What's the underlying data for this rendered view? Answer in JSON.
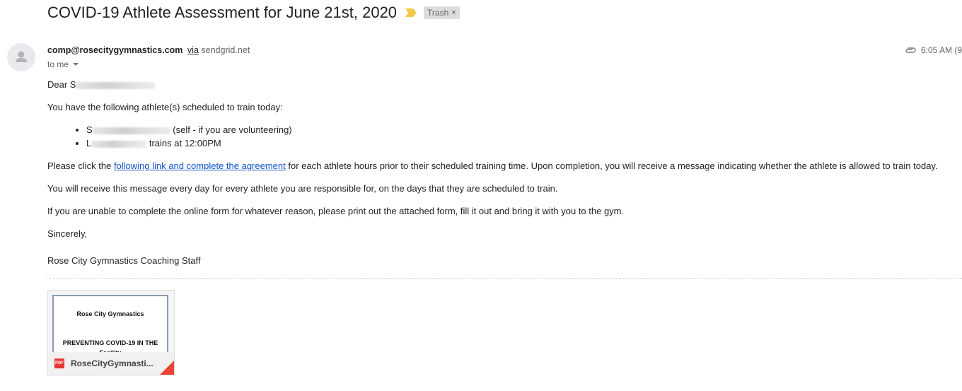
{
  "subject": "COVID-19 Athlete Assessment for June 21st, 2020",
  "label": {
    "name": "Trash",
    "remove": "×"
  },
  "sender": {
    "email": "comp@rosecitygymnastics.com",
    "via_word": "via",
    "via_domain": "sendgrid.net"
  },
  "recipient": {
    "text": "to me"
  },
  "time": "6:05 AM (9",
  "body": {
    "greeting": "Dear S",
    "intro": "You have the following athlete(s) scheduled to train today:",
    "athletes": [
      {
        "prefix": "S",
        "suffix": " (self - if you are volunteering)"
      },
      {
        "prefix": "L",
        "suffix": " trains at 12:00PM"
      }
    ],
    "para2_before": "Please click the ",
    "para2_link": "following link and complete the agreement",
    "para2_after": " for each athlete hours prior to their scheduled training time. Upon completion, you will receive a message indicating whether the athlete is allowed to train today.",
    "para3": "You will receive this message every day for every athlete you are responsible for, on the days that they are scheduled to train.",
    "para4": "If you are unable to complete the online form for whatever reason, please print out the attached form, fill it out and bring it with you to the gym.",
    "closing": "Sincerely,",
    "signature": "Rose City Gymnastics Coaching Staff"
  },
  "attachment": {
    "preview_title": "Rose City Gymnastics",
    "preview_heading": "PREVENTING COVID-19 IN THE",
    "preview_sub": "Facility",
    "type_badge": "PDF",
    "filename": "RoseCityGymnasti..."
  },
  "colors": {
    "link": "#1155cc",
    "importance": "#f2c94c",
    "pdf": "#e53935"
  },
  "icons": [
    "importance-marker-icon",
    "close-icon",
    "avatar-icon",
    "chevron-down-icon",
    "paperclip-icon",
    "pdf-icon"
  ]
}
